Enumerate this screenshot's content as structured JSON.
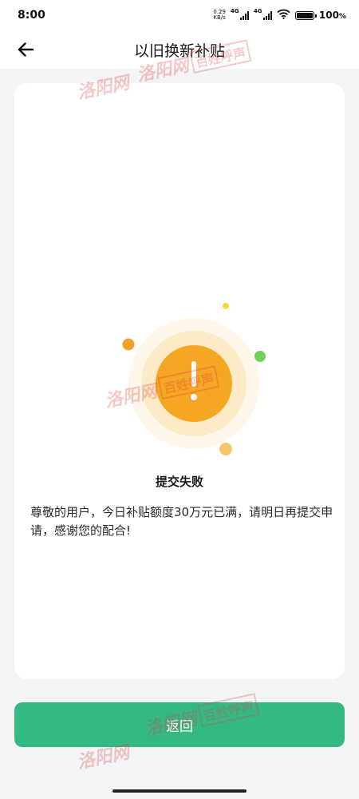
{
  "status_bar": {
    "time": "8:00",
    "net_speed_value": "0.29",
    "net_speed_unit": "KB/s",
    "network_label_1": "4G",
    "network_label_2": "4G",
    "battery_percent": "100",
    "battery_level": 1.0,
    "battery_suffix": "%"
  },
  "nav": {
    "back_icon": "arrow-left-icon",
    "title": "以旧换新补贴"
  },
  "result": {
    "icon": "exclamation-icon",
    "title": "提交失败",
    "message": "尊敬的用户，今日补贴额度30万元已满，请明日再提交申请，感谢您的配合!"
  },
  "actions": {
    "return_label": "返回"
  },
  "watermark": {
    "site": "洛阳网",
    "box": "百姓呼声"
  },
  "colors": {
    "accent": "#34b985",
    "warning": "#f5a623",
    "dot_orange": "#f5a02a",
    "dot_green": "#6cd15a",
    "dot_yellow": "#f2dc3a"
  }
}
